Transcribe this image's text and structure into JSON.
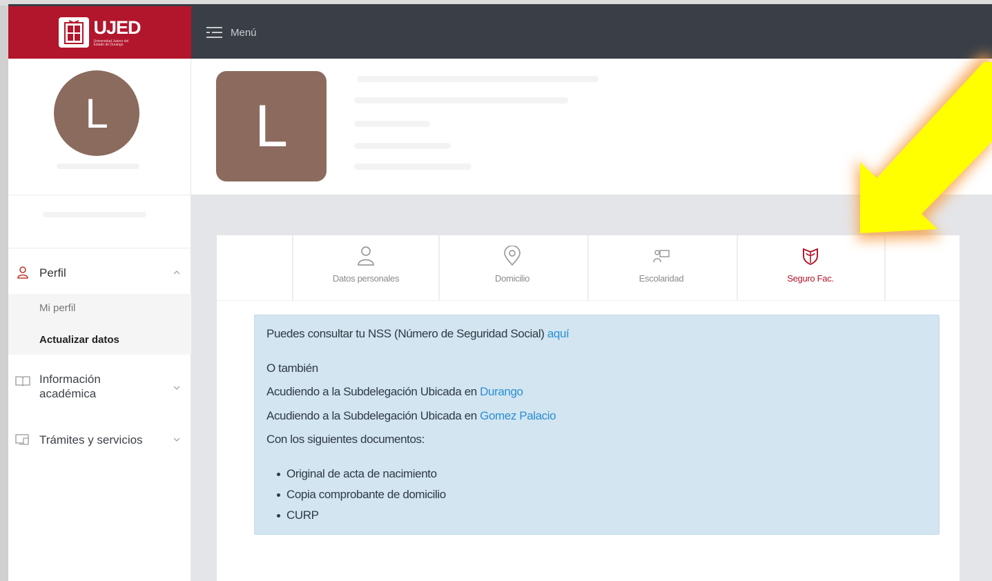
{
  "brand": {
    "name": "UJED",
    "subtitle": "Universidad Juárez del Estado de Durango"
  },
  "topbar": {
    "menu_label": "Menú",
    "menu_icon": "hamburger-icon"
  },
  "sidebar": {
    "avatar_initial": "L",
    "perfil_label": "Perfil",
    "submenu": {
      "mi_perfil": "Mi perfil",
      "actualizar": "Actualizar datos"
    },
    "info_label_line1": "Información",
    "info_label_line2": "académica",
    "tramites_label": "Trámites y servicios"
  },
  "profile": {
    "avatar_initial": "L"
  },
  "tabs": [
    {
      "label": "Datos personales",
      "icon": "user-icon"
    },
    {
      "label": "Domicilio",
      "icon": "map-pin-icon"
    },
    {
      "label": "Escolaridad",
      "icon": "student-icon"
    },
    {
      "label": "Seguro Fac.",
      "icon": "imss-shield-icon",
      "active": true
    }
  ],
  "info": {
    "nss_text": "Puedes consultar tu NSS (Número de Seguridad Social) ",
    "nss_link": "aquí",
    "otherwise": "O también",
    "durango_text": "Acudiendo a la Subdelegación Ubicada en ",
    "durango_link": "Durango",
    "gomez_text": "Acudiendo a la Subdelegación Ubicada en ",
    "gomez_link": "Gomez Palacio",
    "docs_intro": "Con los siguientes documentos:",
    "documents": [
      "Original de acta de nacimiento",
      "Copia comprobante de domicilio",
      "CURP"
    ]
  },
  "colors": {
    "brand_red": "#b2162c",
    "topbar": "#3a3f47",
    "avatar": "#8b6b5d",
    "info_bg": "#d2e5f1",
    "link": "#2b8ed1",
    "arrow": "#ffff00"
  }
}
